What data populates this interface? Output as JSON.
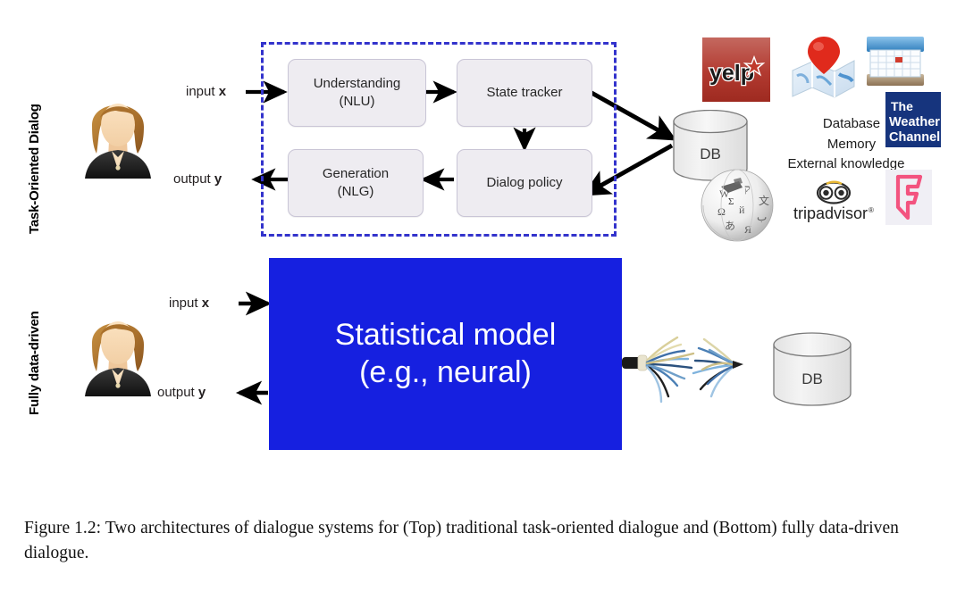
{
  "figure": {
    "caption": "Figure 1.2:  Two architectures of dialogue systems for (Top) traditional task-oriented dialogue and (Bottom) fully data-driven dialogue."
  },
  "colors": {
    "dashed_border": "#3333cc",
    "module_fill": "#eeecf1",
    "module_border": "#c9c5d6",
    "blue_box": "#1620e0",
    "yelp_red": "#af2b23",
    "weather_blue": "#16347d",
    "foursquare_pink": "#f3537f",
    "arrow_black": "#000000"
  },
  "top_section": {
    "row_label": "Task-Oriented Dialog",
    "avatar_name": "user-avatar",
    "input_label_prefix": "input ",
    "input_label_var": "x",
    "output_label_prefix": "output ",
    "output_label_var": "y",
    "modules": [
      {
        "id": "nlu",
        "line1": "Understanding",
        "line2": "(NLU)"
      },
      {
        "id": "state-tracker",
        "line1": "State tracker",
        "line2": ""
      },
      {
        "id": "dialog-policy",
        "line1": "Dialog policy",
        "line2": ""
      },
      {
        "id": "nlg",
        "line1": "Generation",
        "line2": "(NLG)"
      }
    ],
    "database": {
      "label": "DB"
    },
    "knowledge_lines": [
      "Database",
      "Memory",
      "External knowledge"
    ],
    "logos": [
      {
        "id": "yelp",
        "label": "yelp"
      },
      {
        "id": "maps",
        "label": "maps"
      },
      {
        "id": "calendar",
        "label": "calendar"
      },
      {
        "id": "weather-channel",
        "line1": "The",
        "line2": "Weather",
        "line3": "Channel"
      },
      {
        "id": "wikipedia",
        "label": "wikipedia"
      },
      {
        "id": "tripadvisor",
        "label": "tripadvisor",
        "mark": "®"
      },
      {
        "id": "foursquare",
        "label": "foursquare"
      }
    ]
  },
  "bottom_section": {
    "row_label": "Fully data-driven",
    "avatar_name": "user-avatar",
    "input_label_prefix": "input ",
    "input_label_var": "x",
    "output_label_prefix": "output ",
    "output_label_var": "y",
    "model_box": {
      "line1": "Statistical model",
      "line2": "(e.g., neural)"
    },
    "database": {
      "label": "DB"
    },
    "connector_name": "frayed-cable-bundle"
  }
}
